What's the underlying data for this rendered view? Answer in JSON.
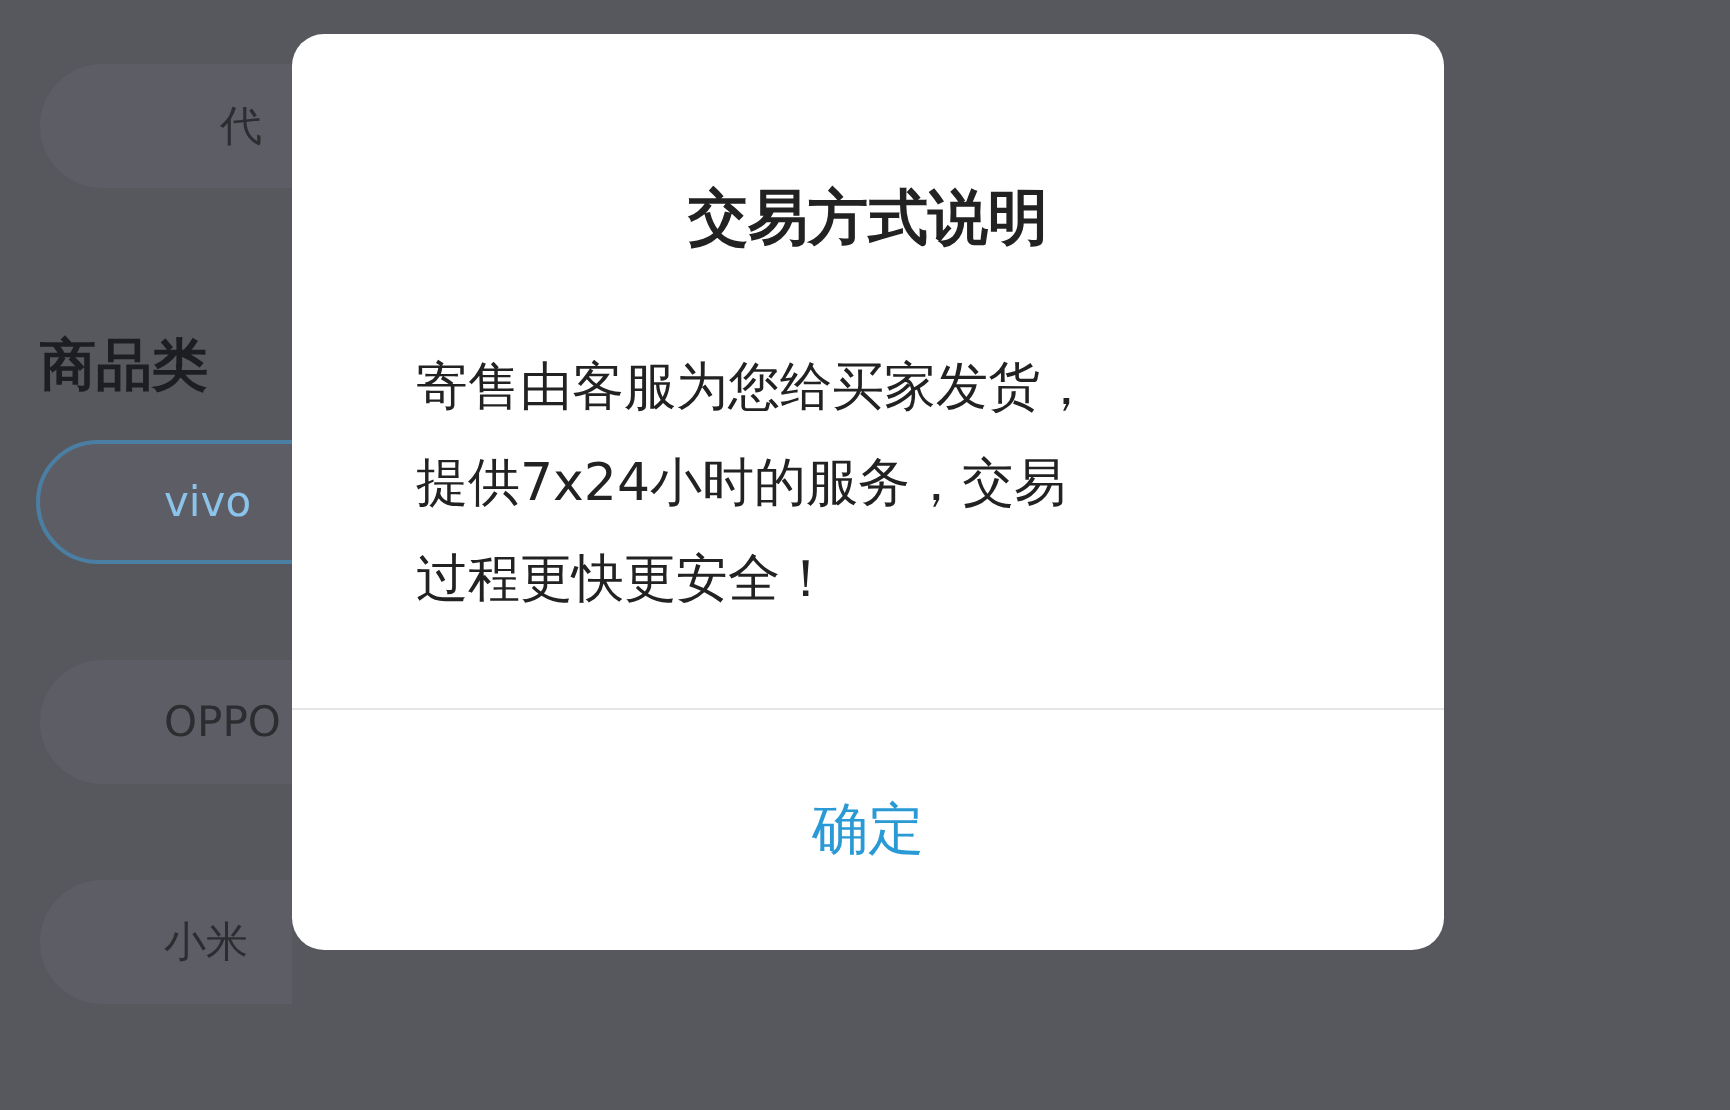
{
  "background": {
    "top_chip": "代",
    "section_title": "商品类",
    "type_options": [
      {
        "label": "vivo",
        "selected": true
      },
      {
        "label": "OPPO",
        "selected": false
      },
      {
        "label": "小米",
        "selected": false
      }
    ]
  },
  "dialog": {
    "title": "交易方式说明",
    "message": "寄售由客服为您给买家发货，提供7x24小时的服务，交易过程更快更安全！",
    "button": "确定"
  }
}
